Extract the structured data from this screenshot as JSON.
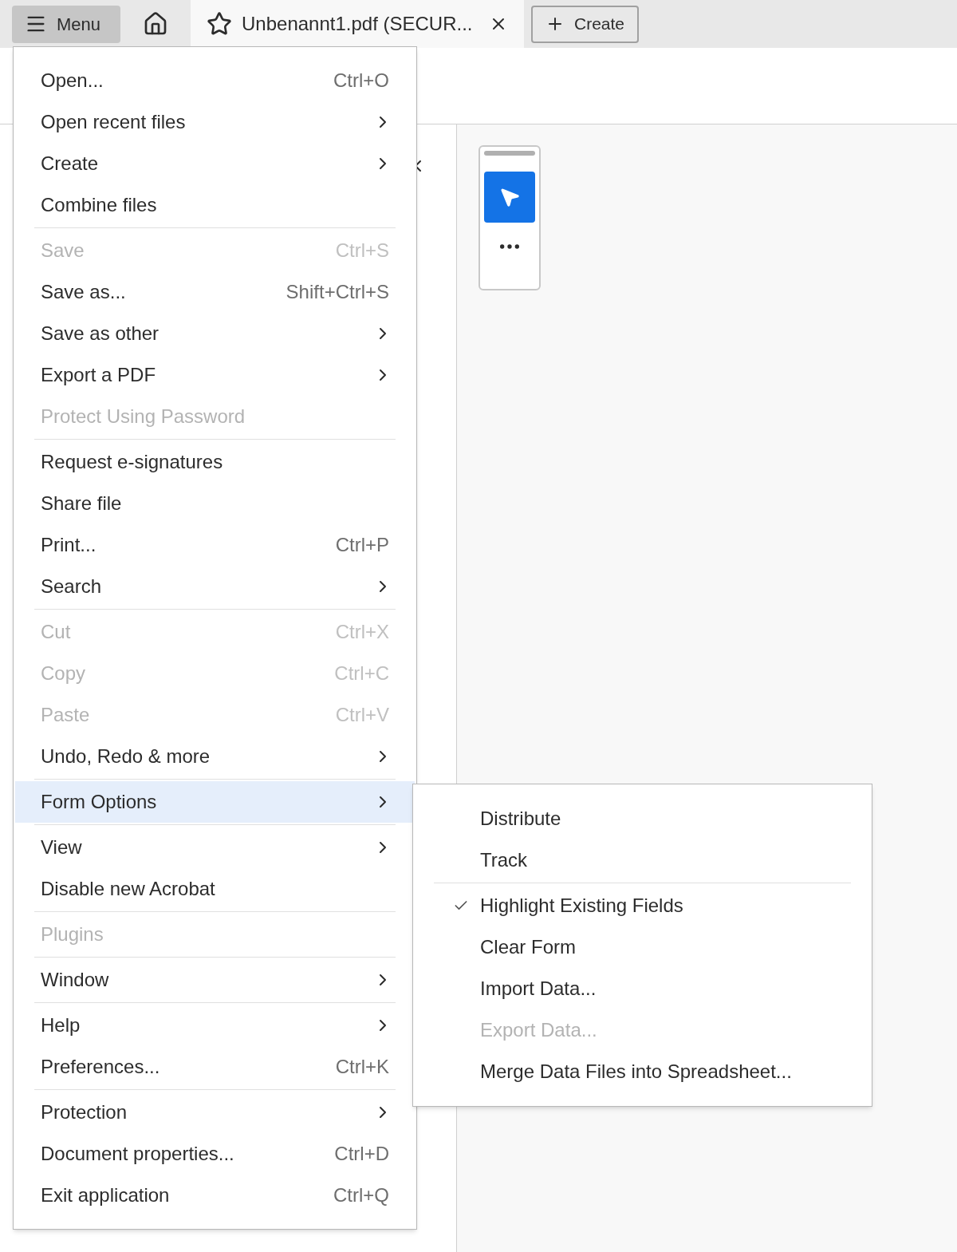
{
  "topbar": {
    "menu_button": "Menu",
    "tab": {
      "title": "Unbenannt1.pdf (SECUR...",
      "selected": true
    },
    "create_button": "Create"
  },
  "menu": {
    "items": [
      {
        "kind": "item",
        "label": "Open...",
        "shortcut": "Ctrl+O",
        "submenu": false,
        "disabled": false,
        "selected": false
      },
      {
        "kind": "item",
        "label": "Open recent files",
        "submenu": true,
        "disabled": false,
        "selected": false
      },
      {
        "kind": "item",
        "label": "Create",
        "submenu": true,
        "disabled": false,
        "selected": false
      },
      {
        "kind": "item",
        "label": "Combine files",
        "submenu": false,
        "disabled": false,
        "selected": false
      },
      {
        "kind": "separator"
      },
      {
        "kind": "item",
        "label": "Save",
        "shortcut": "Ctrl+S",
        "submenu": false,
        "disabled": true,
        "selected": false
      },
      {
        "kind": "item",
        "label": "Save as...",
        "shortcut": "Shift+Ctrl+S",
        "submenu": false,
        "disabled": false,
        "selected": false
      },
      {
        "kind": "item",
        "label": "Save as other",
        "submenu": true,
        "disabled": false,
        "selected": false
      },
      {
        "kind": "item",
        "label": "Export a PDF",
        "submenu": true,
        "disabled": false,
        "selected": false
      },
      {
        "kind": "item",
        "label": "Protect Using Password",
        "submenu": false,
        "disabled": true,
        "selected": false
      },
      {
        "kind": "separator"
      },
      {
        "kind": "item",
        "label": "Request e-signatures",
        "submenu": false,
        "disabled": false,
        "selected": false
      },
      {
        "kind": "item",
        "label": "Share file",
        "submenu": false,
        "disabled": false,
        "selected": false
      },
      {
        "kind": "item",
        "label": "Print...",
        "shortcut": "Ctrl+P",
        "submenu": false,
        "disabled": false,
        "selected": false
      },
      {
        "kind": "item",
        "label": "Search",
        "submenu": true,
        "disabled": false,
        "selected": false
      },
      {
        "kind": "separator"
      },
      {
        "kind": "item",
        "label": "Cut",
        "shortcut": "Ctrl+X",
        "submenu": false,
        "disabled": true,
        "selected": false
      },
      {
        "kind": "item",
        "label": "Copy",
        "shortcut": "Ctrl+C",
        "submenu": false,
        "disabled": true,
        "selected": false
      },
      {
        "kind": "item",
        "label": "Paste",
        "shortcut": "Ctrl+V",
        "submenu": false,
        "disabled": true,
        "selected": false
      },
      {
        "kind": "item",
        "label": "Undo, Redo & more",
        "submenu": true,
        "disabled": false,
        "selected": false
      },
      {
        "kind": "separator"
      },
      {
        "kind": "item",
        "label": "Form Options",
        "submenu": true,
        "disabled": false,
        "selected": true
      },
      {
        "kind": "separator"
      },
      {
        "kind": "item",
        "label": "View",
        "submenu": true,
        "disabled": false,
        "selected": false
      },
      {
        "kind": "item",
        "label": "Disable new Acrobat",
        "submenu": false,
        "disabled": false,
        "selected": false
      },
      {
        "kind": "separator"
      },
      {
        "kind": "item",
        "label": "Plugins",
        "submenu": false,
        "disabled": true,
        "selected": false
      },
      {
        "kind": "separator"
      },
      {
        "kind": "item",
        "label": "Window",
        "submenu": true,
        "disabled": false,
        "selected": false
      },
      {
        "kind": "separator"
      },
      {
        "kind": "item",
        "label": "Help",
        "submenu": true,
        "disabled": false,
        "selected": false
      },
      {
        "kind": "item",
        "label": "Preferences...",
        "shortcut": "Ctrl+K",
        "submenu": false,
        "disabled": false,
        "selected": false
      },
      {
        "kind": "separator"
      },
      {
        "kind": "item",
        "label": "Protection",
        "submenu": true,
        "disabled": false,
        "selected": false
      },
      {
        "kind": "item",
        "label": "Document properties...",
        "shortcut": "Ctrl+D",
        "submenu": false,
        "disabled": false,
        "selected": false
      },
      {
        "kind": "item",
        "label": "Exit application",
        "shortcut": "Ctrl+Q",
        "submenu": false,
        "disabled": false,
        "selected": false
      }
    ]
  },
  "submenu": {
    "items": [
      {
        "kind": "item",
        "label": "Distribute",
        "checked": false,
        "disabled": false
      },
      {
        "kind": "item",
        "label": "Track",
        "checked": false,
        "disabled": false
      },
      {
        "kind": "separator"
      },
      {
        "kind": "item",
        "label": "Highlight Existing Fields",
        "checked": true,
        "disabled": false
      },
      {
        "kind": "item",
        "label": "Clear Form",
        "checked": false,
        "disabled": false
      },
      {
        "kind": "item",
        "label": "Import Data...",
        "checked": false,
        "disabled": false
      },
      {
        "kind": "item",
        "label": "Export Data...",
        "checked": false,
        "disabled": true
      },
      {
        "kind": "item",
        "label": "Merge Data Files into Spreadsheet...",
        "checked": false,
        "disabled": false
      }
    ]
  }
}
